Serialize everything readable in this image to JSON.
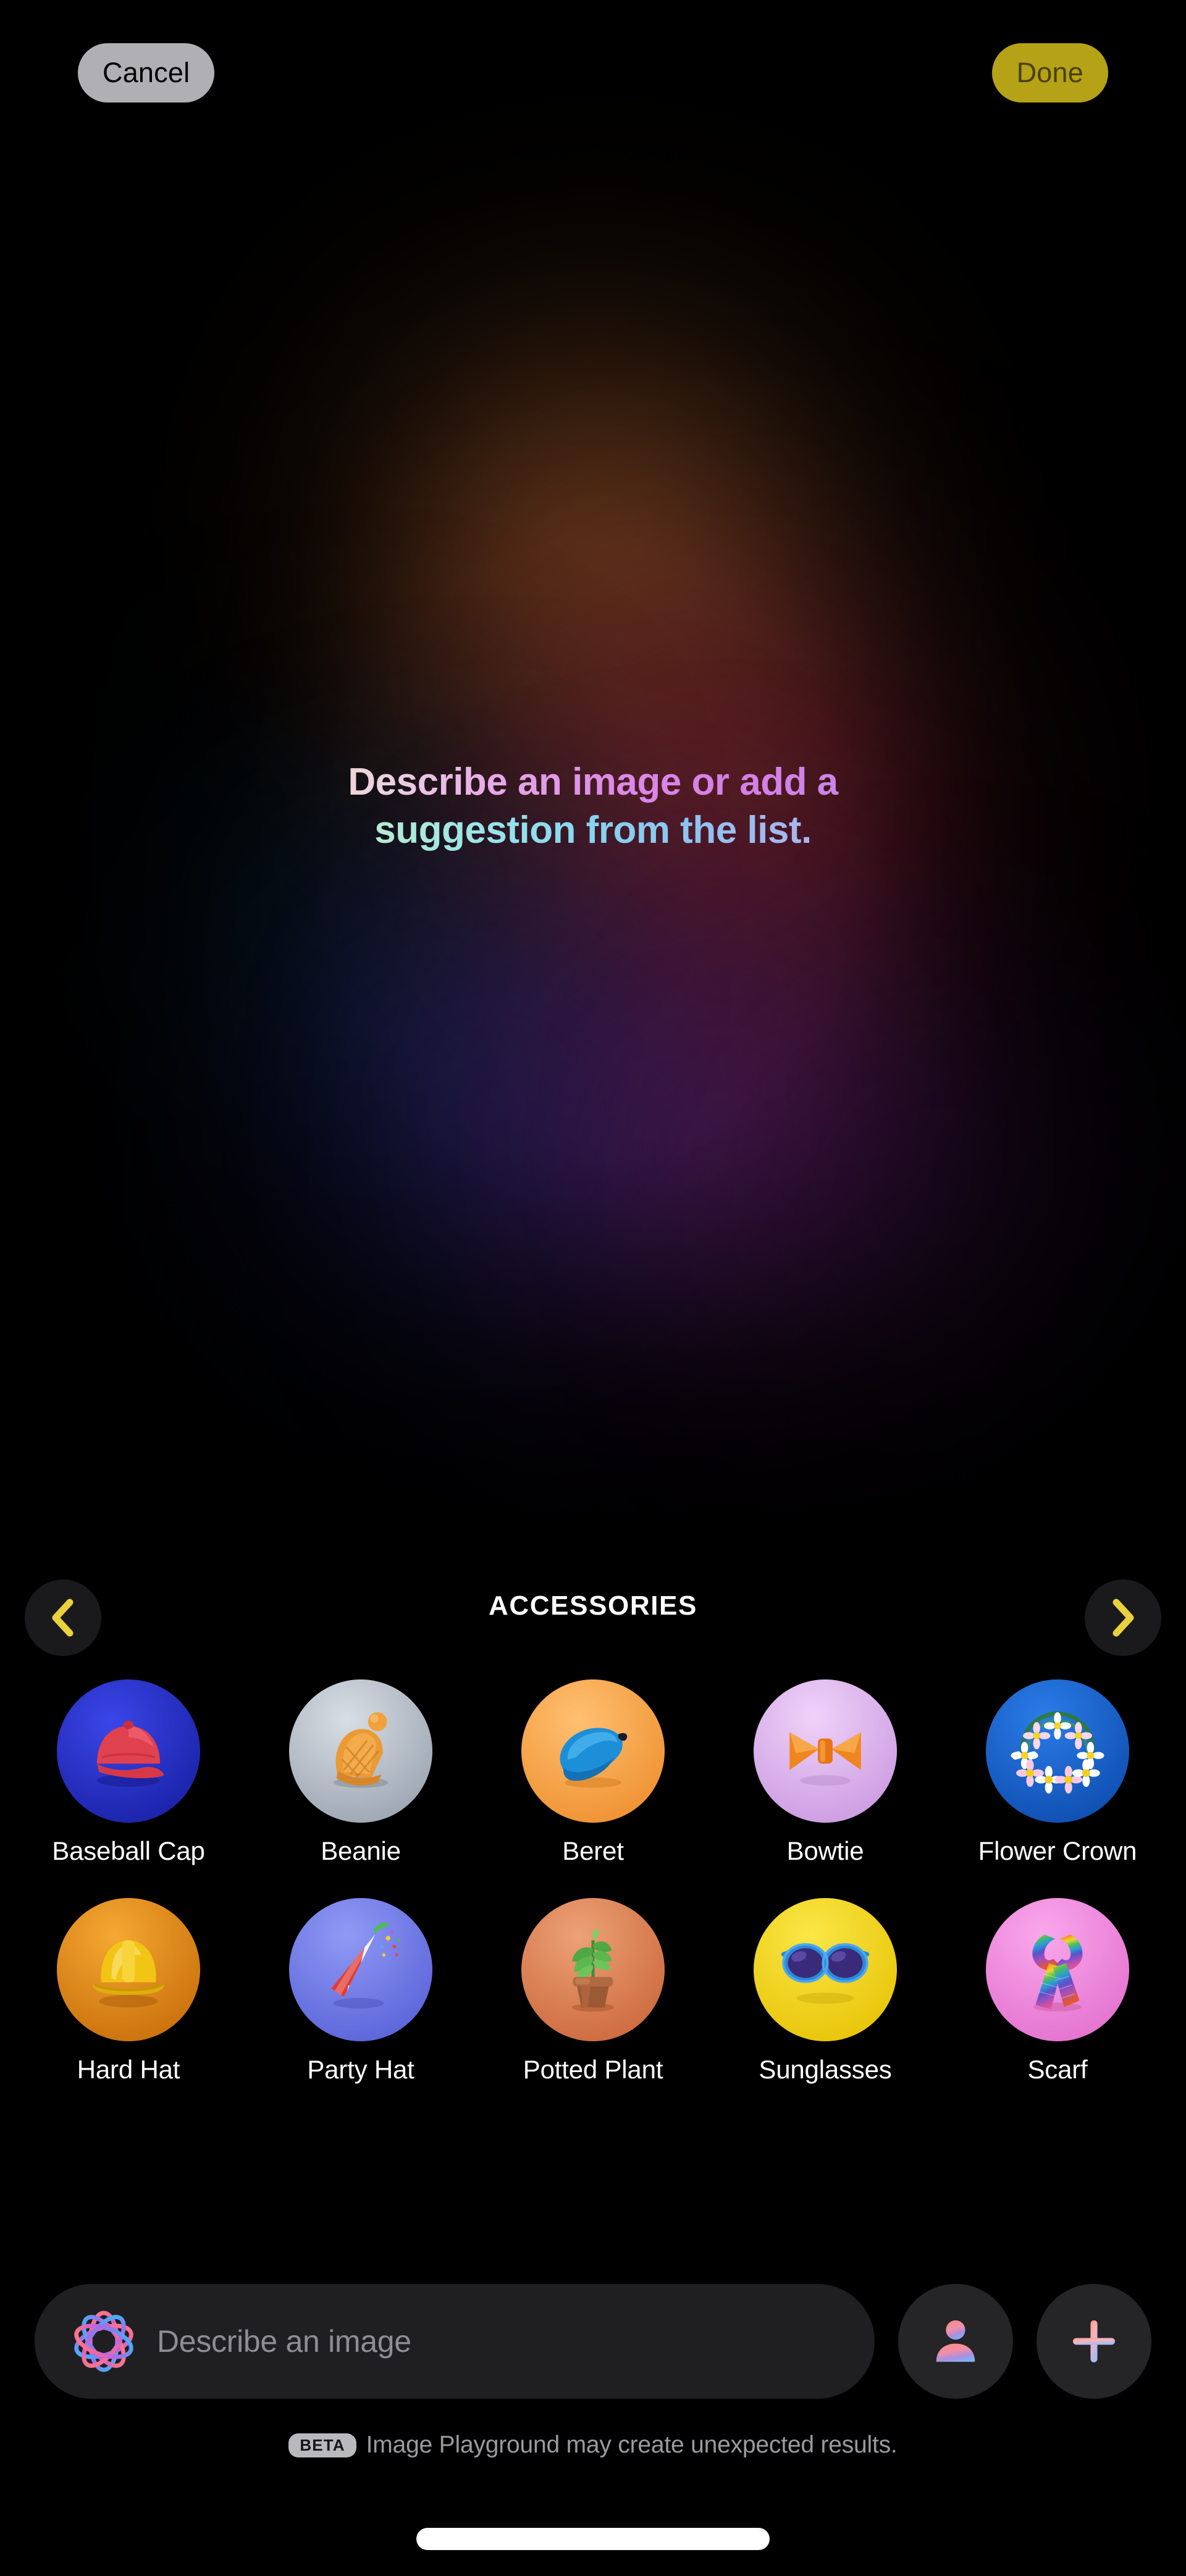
{
  "topbar": {
    "cancel_label": "Cancel",
    "done_label": "Done",
    "cancel_bg": "#b0b0b4",
    "done_bg": "#b6a216",
    "done_fg": "#4a4000"
  },
  "headline": {
    "line1": "Describe an image or add a",
    "line2": "suggestion from the list."
  },
  "category_nav": {
    "title": "ACCESSORIES",
    "prev_label": "‹",
    "next_label": "›",
    "arrow_color": "#e8d13c"
  },
  "items": [
    {
      "label": "Baseball Cap",
      "icon": "baseball-cap",
      "bg": "#2b36d8",
      "bg2": "#1e27b0"
    },
    {
      "label": "Beanie",
      "icon": "beanie",
      "bg": "#c6ccd4",
      "bg2": "#a8b0bb"
    },
    {
      "label": "Beret",
      "icon": "beret",
      "bg": "#f9ab4e",
      "bg2": "#ef9436"
    },
    {
      "label": "Bowtie",
      "icon": "bowtie",
      "bg": "#e2b9ef",
      "bg2": "#d3a4e6"
    },
    {
      "label": "Flower Crown",
      "icon": "flower-crown",
      "bg": "#1b66d6",
      "bg2": "#1450b8"
    },
    {
      "label": "Hard Hat",
      "icon": "hard-hat",
      "bg": "#e08a16",
      "bg2": "#c87610"
    },
    {
      "label": "Party Hat",
      "icon": "party-hat",
      "bg": "#7c86ed",
      "bg2": "#6670e2"
    },
    {
      "label": "Potted Plant",
      "icon": "potted-plant",
      "bg": "#e08a5e",
      "bg2": "#cc744a"
    },
    {
      "label": "Sunglasses",
      "icon": "sunglasses",
      "bg": "#f5d92a",
      "bg2": "#edcb14"
    },
    {
      "label": "Scarf",
      "icon": "scarf",
      "bg": "#ef8ede",
      "bg2": "#e578d2"
    }
  ],
  "prompt": {
    "placeholder": "Describe an image",
    "value": "",
    "ai_icon": "apple-intelligence-icon",
    "person_icon": "person-icon",
    "add_icon": "plus-icon"
  },
  "footer": {
    "badge": "BETA",
    "text": "Image Playground may create unexpected results."
  }
}
